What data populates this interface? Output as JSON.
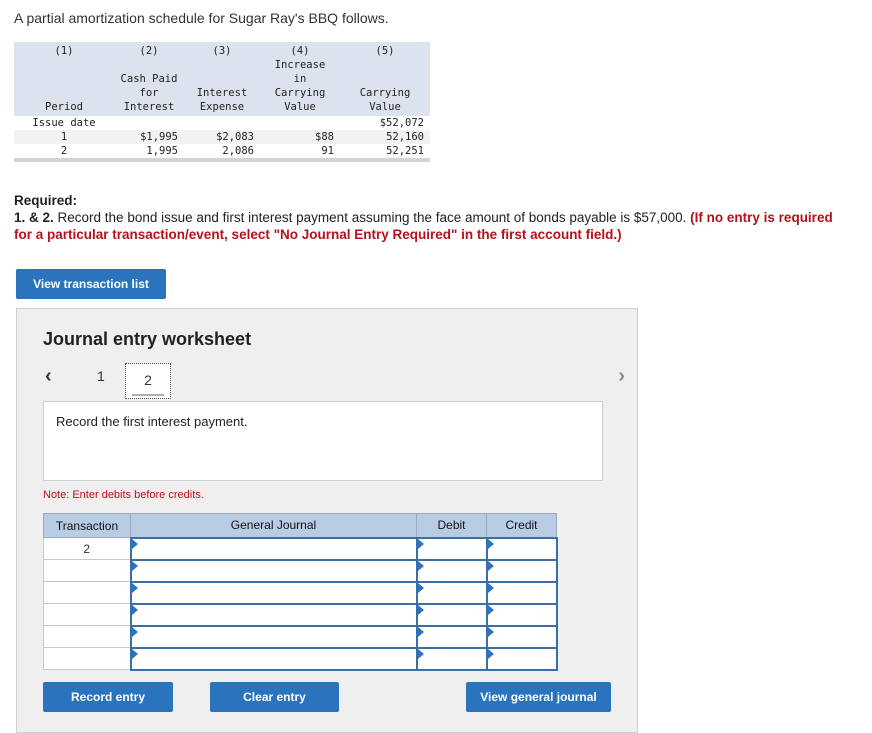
{
  "intro": "A partial amortization schedule for Sugar Ray's BBQ follows.",
  "schedule": {
    "col_numbers": [
      "(1)",
      "(2)",
      "(3)",
      "(4)",
      "(5)"
    ],
    "headers": {
      "period": "Period",
      "cash_paid": [
        "Cash Paid",
        "for",
        "Interest"
      ],
      "interest_expense": [
        "Interest",
        "Expense"
      ],
      "increase": [
        "Increase",
        "in",
        "Carrying",
        "Value"
      ],
      "carrying": [
        "Carrying",
        "Value"
      ]
    },
    "rows": [
      {
        "period": "Issue date",
        "cash": "",
        "interest": "",
        "increase": "",
        "carrying": "$52,072"
      },
      {
        "period": "1",
        "cash": "$1,995",
        "interest": "$2,083",
        "increase": "$88",
        "carrying": "52,160"
      },
      {
        "period": "2",
        "cash": "1,995",
        "interest": "2,086",
        "increase": "91",
        "carrying": "52,251"
      }
    ]
  },
  "required": {
    "label": "Required:",
    "num": "1. & 2.",
    "text": " Record the bond issue and first interest payment assuming the face amount of bonds payable is $57,000. ",
    "red": "(If no entry is required for a particular transaction/event, select \"No Journal Entry Required\" in the first account field.)"
  },
  "buttons": {
    "view_transaction_list": "View transaction list",
    "record_entry": "Record entry",
    "clear_entry": "Clear entry",
    "view_general_journal": "View general journal"
  },
  "worksheet": {
    "title": "Journal entry worksheet",
    "pages": [
      "1",
      "2"
    ],
    "current_page": "2",
    "description": "Record the first interest payment.",
    "note": "Note: Enter debits before credits.",
    "columns": [
      "Transaction",
      "General Journal",
      "Debit",
      "Credit"
    ],
    "transaction": "2"
  },
  "colors": {
    "button": "#2a73bd",
    "header": "#b8cce4",
    "note_red": "#b5121b"
  }
}
